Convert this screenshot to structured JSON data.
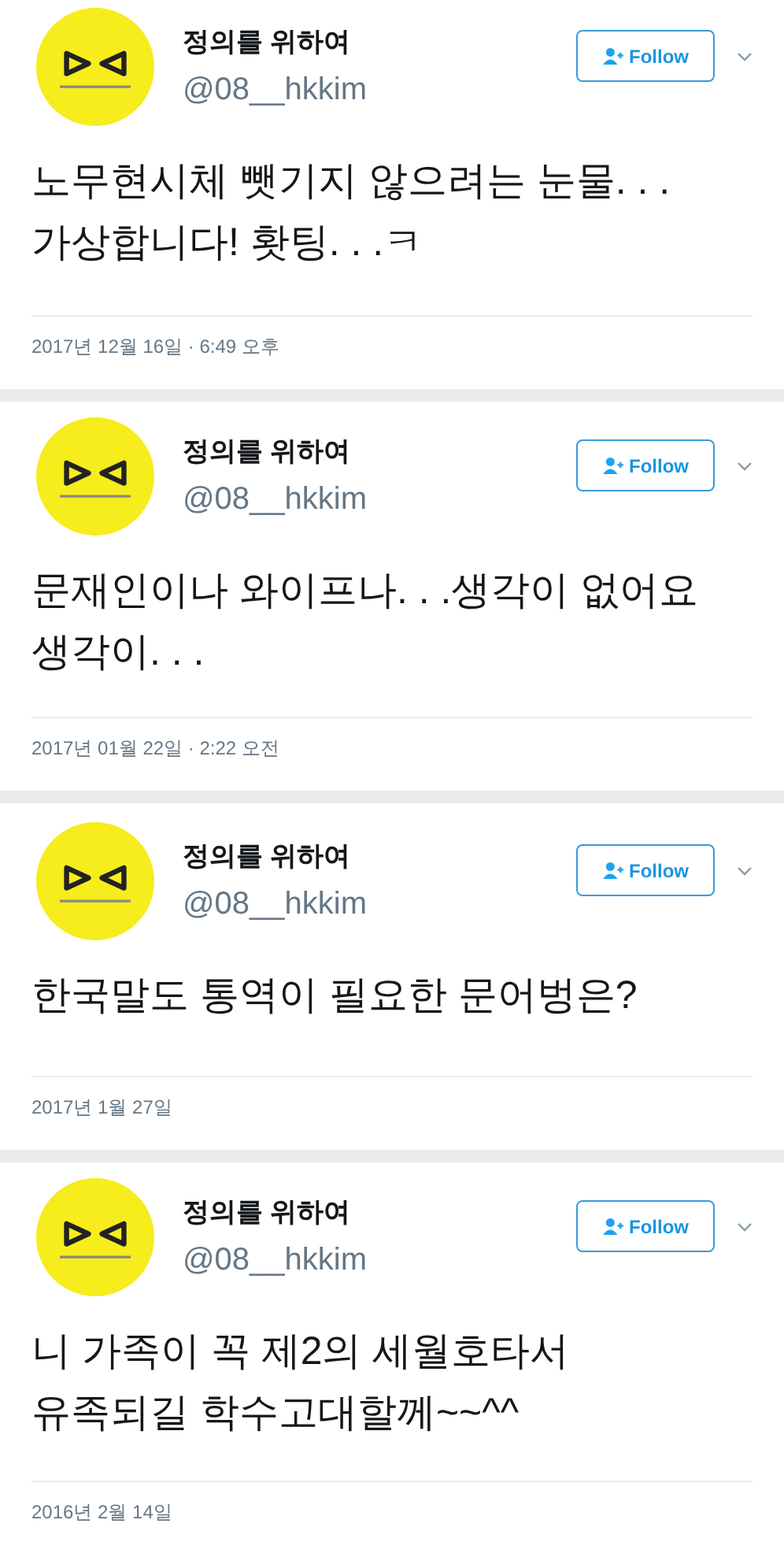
{
  "tweets": [
    {
      "name": "정의를 위하여",
      "handle": "@08__hkkim",
      "follow": "Follow",
      "text_lines": [
        "노무현시체 뺏기지 않으려는 눈물. . .",
        "가상합니다! 홧팅. . .ㅋ"
      ],
      "date": "2017년 12월 16일 · 6:49 오후"
    },
    {
      "name": "정의를 위하여",
      "handle": "@08__hkkim",
      "follow": "Follow",
      "text_lines": [
        "문재인이나 와이프나. . .생각이 없어요",
        "생각이. . ."
      ],
      "date": "2017년 01월 22일 · 2:22 오전"
    },
    {
      "name": "정의를 위하여",
      "handle": "@08__hkkim",
      "follow": "Follow",
      "text_lines": [
        "한국말도 통역이 필요한 문어벙은?"
      ],
      "date": "2017년 1월 27일"
    },
    {
      "name": "정의를 위하여",
      "handle": "@08__hkkim",
      "follow": "Follow",
      "text_lines": [
        "니 가족이 꼭 제2의 세월호타서",
        "유족되길 학수고대할께~~^^"
      ],
      "date": "2016년 2월 14일"
    }
  ]
}
